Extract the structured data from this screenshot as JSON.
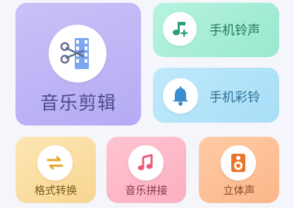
{
  "tiles": {
    "audio_edit": {
      "label": "音乐剪辑",
      "icon": "scissors-film-icon",
      "color": "#b5abf3"
    },
    "ringtone": {
      "label": "手机铃声",
      "icon": "music-note-plus-icon",
      "color": "#9ae8cf"
    },
    "color_ring": {
      "label": "手机彩铃",
      "icon": "bell-icon",
      "color": "#a8def7"
    },
    "format_convert": {
      "label": "格式转换",
      "icon": "swap-arrows-icon",
      "color": "#f8d591"
    },
    "audio_concat": {
      "label": "音乐拼接",
      "icon": "music-note-icon",
      "color": "#fbb0c1"
    },
    "stereo": {
      "label": "立体声",
      "icon": "speaker-icon",
      "color": "#fbb78a"
    }
  }
}
